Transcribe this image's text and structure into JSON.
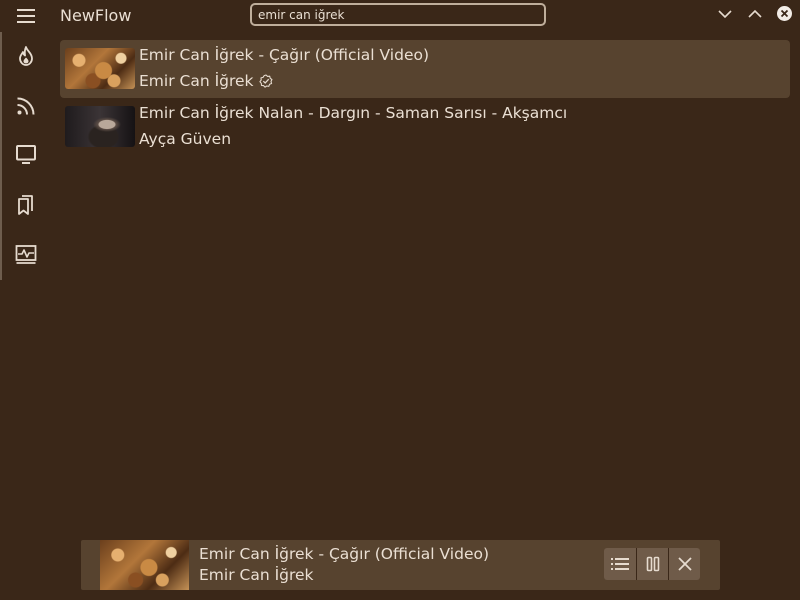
{
  "app": {
    "title": "NewFlow"
  },
  "search": {
    "value": "emir can iğrek",
    "placeholder": ""
  },
  "window_controls": [
    "chevron-down-icon",
    "chevron-up-icon",
    "close-icon"
  ],
  "sidebar": {
    "items": [
      {
        "icon": "fire-icon"
      },
      {
        "icon": "rss-icon"
      },
      {
        "icon": "tv-icon"
      },
      {
        "icon": "bookmarks-icon"
      },
      {
        "icon": "activity-monitor-icon"
      }
    ]
  },
  "results": [
    {
      "title": "Emir Can İğrek - Çağır (Official Video)",
      "channel": "Emir Can İğrek",
      "verified": true,
      "active": true
    },
    {
      "title": "Emir Can İğrek Nalan - Dargın - Saman Sarısı - Akşamcı",
      "channel": "Ayça Güven",
      "verified": false,
      "active": false
    }
  ],
  "player": {
    "title": "Emir Can İğrek - Çağır (Official Video)",
    "channel": "Emir Can İğrek",
    "buttons": [
      "queue-list-icon",
      "pause-icon",
      "close-icon"
    ]
  },
  "colors": {
    "background": "#3a2718",
    "surface": "#57432f",
    "button_group": "#6f5b49",
    "text": "#eadfd3",
    "icon": "#e6dbcf"
  }
}
